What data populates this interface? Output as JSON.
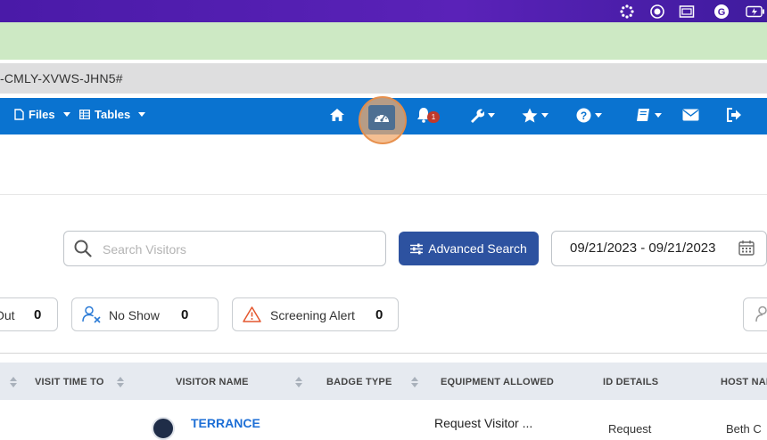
{
  "url": {
    "text": "-CMLY-XVWS-JHN5#"
  },
  "nav": {
    "files_label": "Files",
    "tables_label": "Tables",
    "notification_count": "1"
  },
  "search": {
    "placeholder": "Search Visitors",
    "advanced_label": "Advanced Search",
    "date_range": "09/21/2023 - 09/21/2023"
  },
  "status_chips": [
    {
      "label": "Out",
      "count": "0"
    },
    {
      "label": "No Show",
      "count": "0"
    },
    {
      "label": "Screening Alert",
      "count": "0"
    }
  ],
  "table": {
    "headers": [
      "VISIT TIME TO",
      "VISITOR NAME",
      "BADGE TYPE",
      "EQUIPMENT ALLOWED",
      "ID DETAILS",
      "HOST NAI"
    ],
    "rows": [
      {
        "visitor_name": "TERRANCE",
        "equipment": "Request Visitor ...",
        "id_details": "Request",
        "host": "Beth C"
      }
    ]
  },
  "colors": {
    "nav_bg": "#0a73d0",
    "os_bar": "#4a1aa8",
    "banner": "#cde9c4",
    "primary_button": "#2d52a0",
    "badge": "#c0392b"
  }
}
